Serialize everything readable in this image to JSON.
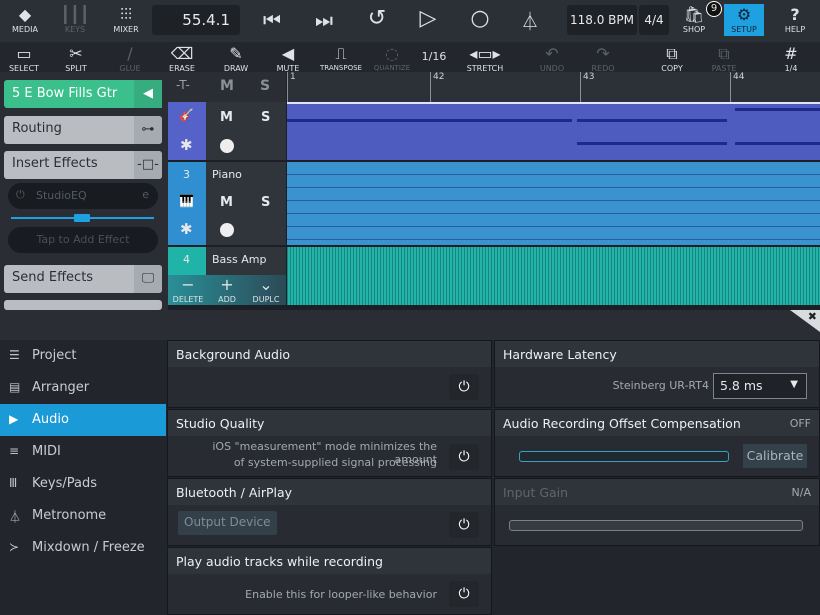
{
  "topbar": {
    "media": "MEDIA",
    "keys": "KEYS",
    "mixer": "MIXER",
    "position": "55.4.1",
    "tempo": "118.0 BPM",
    "signature": "4/4",
    "shop": "SHOP",
    "shop_badge": "9",
    "setup": "SETUP",
    "help": "HELP",
    "accent": "#1ea1e0"
  },
  "toolbar": {
    "select": "SELECT",
    "split": "SPLIT",
    "glue": "GLUE",
    "erase": "ERASE",
    "draw": "DRAW",
    "mute": "MUTE",
    "transpose": "TRANSPOSE",
    "quantize": "QUANTIZE",
    "quant_value": "1/16",
    "stretch": "STRETCH",
    "undo": "UNDO",
    "redo": "REDO",
    "copy": "COPY",
    "paste": "PASTE",
    "grid": "1/4"
  },
  "ruler": {
    "marks": [
      "1",
      "42",
      "43",
      "44"
    ]
  },
  "inspector": {
    "track": "5  E Bow Fills Gtr",
    "routing": "Routing",
    "insert": "Insert Effects",
    "effect": "StudioEQ",
    "add_effect": "Tap to Add Effect",
    "send": "Send Effects"
  },
  "tracks": [
    {
      "num": "",
      "name": "",
      "m": "M",
      "s": "S",
      "color": "#5563c8"
    },
    {
      "num": "3",
      "name": "Piano",
      "m": "M",
      "s": "S",
      "color": "#2f8fd0"
    },
    {
      "num": "4",
      "name": "Bass Amp",
      "color": "#20b3a7"
    }
  ],
  "track_actions": {
    "delete": "DELETE",
    "add": "ADD",
    "duplicate": "DUPLC"
  },
  "settings": {
    "nav": [
      "Project",
      "Arranger",
      "Audio",
      "MIDI",
      "Keys/Pads",
      "Metronome",
      "Mixdown / Freeze"
    ],
    "background_audio": "Background Audio",
    "studio_quality": "Studio Quality",
    "studio_quality_desc1": "iOS \"measurement\" mode minimizes the amount",
    "studio_quality_desc2": "of system-supplied signal processing",
    "bluetooth": "Bluetooth / AirPlay",
    "output_device": "Output Device",
    "play_while_rec": "Play audio tracks while recording",
    "play_while_rec_desc": "Enable this for looper-like behavior",
    "hw_latency": "Hardware Latency",
    "device": "Steinberg UR-RT4",
    "latency_value": "5.8 ms",
    "offset": "Audio Recording Offset Compensation",
    "offset_state": "OFF",
    "calibrate": "Calibrate",
    "input_gain": "Input Gain",
    "input_gain_state": "N/A"
  }
}
